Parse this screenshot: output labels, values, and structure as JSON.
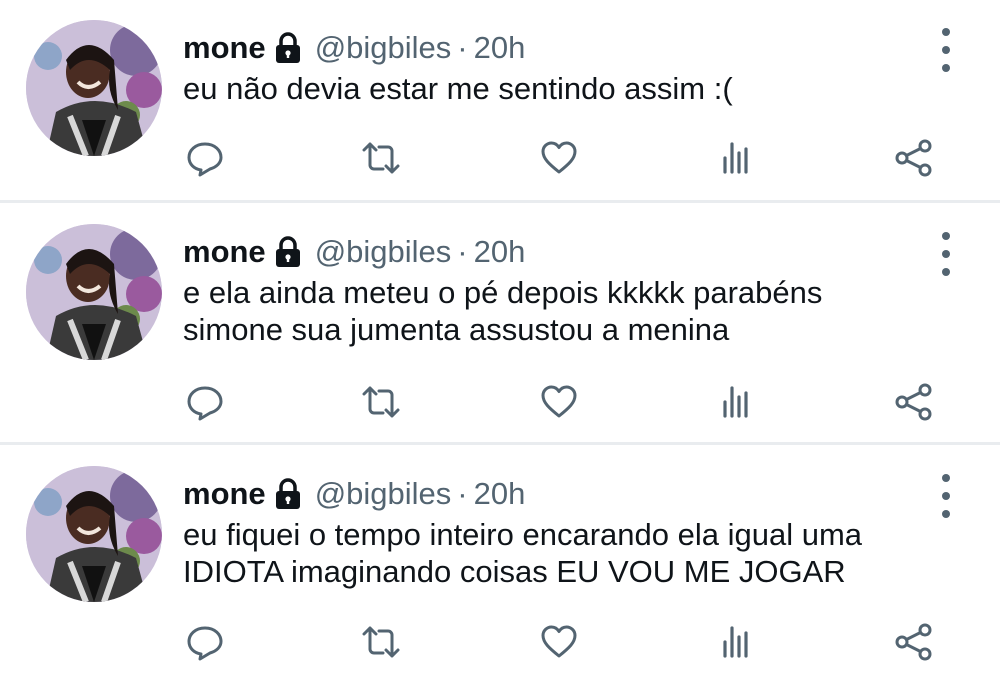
{
  "tweets": [
    {
      "name": "mone",
      "handle": "@bigbiles",
      "separator": "·",
      "time": "20h",
      "lines": [
        "eu não devia estar me sentindo assim :("
      ]
    },
    {
      "name": "mone",
      "handle": "@bigbiles",
      "separator": "·",
      "time": "20h",
      "lines": [
        "e ela ainda meteu o pé depois kkkkk parabéns",
        "simone sua jumenta assustou a menina"
      ]
    },
    {
      "name": "mone",
      "handle": "@bigbiles",
      "separator": "·",
      "time": "20h",
      "lines": [
        "eu fiquei o tempo inteiro encarando ela igual uma",
        "IDIOTA imaginando coisas EU VOU ME JOGAR"
      ]
    }
  ],
  "icons": {
    "protected": "lock-icon",
    "more": "more-vertical-icon",
    "reply": "reply-icon",
    "retweet": "retweet-icon",
    "like": "heart-icon",
    "stats": "stats-icon",
    "share": "share-icon"
  },
  "colors": {
    "text": "#0f1419",
    "secondary": "#536471",
    "divider": "#e9ecef"
  }
}
